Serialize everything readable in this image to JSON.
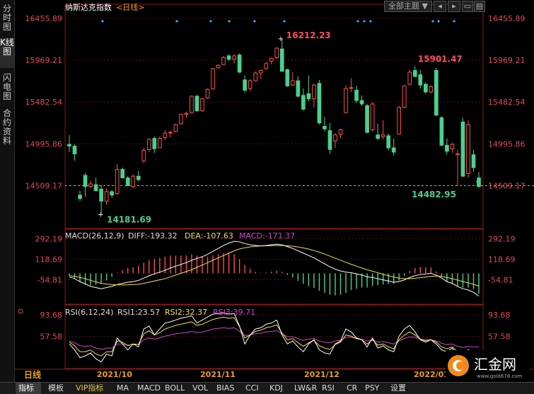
{
  "side_tabs": [
    {
      "label": "分时图",
      "active": false
    },
    {
      "label": "K线图",
      "active": true
    },
    {
      "label": "闪电图",
      "active": false
    },
    {
      "label": "合约资料",
      "active": false
    }
  ],
  "header": {
    "title": "纳斯达克指数",
    "period": "<日线>",
    "theme_button": "全部主题",
    "caret": "▼"
  },
  "colors": {
    "up": "#ff4d4d",
    "down": "#4ccf8f",
    "axis": "#e04a5a",
    "grid": "#5a1010",
    "ma": "#ffffff",
    "dea": "#f0e050",
    "macd": "#cc44cc",
    "rsi1": "#ffffff",
    "rsi2": "#f0e050",
    "rsi3": "#cc44cc",
    "dot": "#4aa3ff"
  },
  "chart_data": {
    "type": "candlestick",
    "ylim": [
      14020,
      16620
    ],
    "price_ticks": [
      "16455.89",
      "15969.21",
      "15482.54",
      "14995.86",
      "14509.17"
    ],
    "last_price_line": "14509.17",
    "x_labels": [
      "2021/10",
      "2021/11",
      "2021/12",
      "2022/01"
    ],
    "annotations": {
      "high": "16212.23",
      "low": "14181.69",
      "peak2": "15901.47",
      "low2": "14482.95"
    },
    "candles": [
      [
        14990,
        15100,
        14900,
        14970
      ],
      [
        14970,
        14990,
        14800,
        14880
      ],
      [
        14400,
        14450,
        14330,
        14360
      ],
      [
        14630,
        14660,
        14380,
        14500
      ],
      [
        14500,
        14570,
        14480,
        14530
      ],
      [
        14520,
        14600,
        14450,
        14450
      ],
      [
        14470,
        14520,
        14180,
        14330
      ],
      [
        14330,
        14480,
        14290,
        14440
      ],
      [
        14440,
        14460,
        14370,
        14400
      ],
      [
        14420,
        14760,
        14400,
        14700
      ],
      [
        14700,
        14720,
        14600,
        14600
      ],
      [
        14600,
        14620,
        14510,
        14510
      ],
      [
        14500,
        14640,
        14480,
        14620
      ],
      [
        14620,
        14680,
        14560,
        14580
      ],
      [
        14800,
        14950,
        14770,
        14920
      ],
      [
        14930,
        15060,
        14900,
        15050
      ],
      [
        15060,
        15080,
        14890,
        14940
      ],
      [
        14950,
        15080,
        14950,
        15060
      ],
      [
        15070,
        15160,
        15040,
        15120
      ],
      [
        15130,
        15150,
        15070,
        15130
      ],
      [
        15140,
        15230,
        15130,
        15220
      ],
      [
        15230,
        15340,
        15220,
        15340
      ],
      [
        15340,
        15370,
        15300,
        15350
      ],
      [
        15360,
        15560,
        15350,
        15550
      ],
      [
        15550,
        15570,
        15370,
        15380
      ],
      [
        15380,
        15530,
        15370,
        15520
      ],
      [
        15530,
        15640,
        15520,
        15630
      ],
      [
        15640,
        15880,
        15620,
        15870
      ],
      [
        15880,
        15920,
        15870,
        15910
      ],
      [
        15920,
        16020,
        15910,
        16000
      ],
      [
        16020,
        16040,
        15960,
        15980
      ],
      [
        15980,
        16040,
        15930,
        16020
      ],
      [
        16030,
        16050,
        15820,
        15830
      ],
      [
        15740,
        15790,
        15590,
        15620
      ],
      [
        15640,
        15750,
        15610,
        15730
      ],
      [
        15730,
        15840,
        15720,
        15820
      ],
      [
        15820,
        15860,
        15750,
        15850
      ],
      [
        15870,
        15950,
        15860,
        15930
      ],
      [
        15960,
        16000,
        15920,
        15990
      ],
      [
        16000,
        16120,
        15980,
        16110
      ],
      [
        16100,
        16210,
        15850,
        15840
      ],
      [
        15860,
        15870,
        15660,
        15670
      ],
      [
        15680,
        15830,
        15670,
        15730
      ],
      [
        15730,
        15780,
        15540,
        15550
      ],
      [
        15560,
        15640,
        15380,
        15400
      ],
      [
        15580,
        15790,
        15490,
        15520
      ],
      [
        15520,
        15700,
        15420,
        15680
      ],
      [
        15700,
        15740,
        15220,
        15240
      ],
      [
        15200,
        15310,
        15140,
        15170
      ],
      [
        15150,
        15240,
        14880,
        14930
      ],
      [
        15030,
        15120,
        14950,
        15100
      ],
      [
        15110,
        15170,
        15060,
        15160
      ],
      [
        15360,
        15680,
        15350,
        15640
      ],
      [
        15650,
        15760,
        15600,
        15650
      ],
      [
        15620,
        15670,
        15470,
        15500
      ],
      [
        15500,
        15560,
        15440,
        15460
      ],
      [
        15440,
        15460,
        15120,
        15130
      ],
      [
        15160,
        15480,
        15140,
        15460
      ],
      [
        15100,
        15230,
        15040,
        15060
      ],
      [
        15080,
        15270,
        15050,
        15100
      ],
      [
        15090,
        15120,
        14920,
        14950
      ],
      [
        14950,
        15060,
        14860,
        14900
      ],
      [
        15110,
        15440,
        15110,
        15420
      ],
      [
        15420,
        15680,
        15410,
        15670
      ],
      [
        15690,
        15860,
        15680,
        15830
      ],
      [
        15850,
        15900,
        15770,
        15780
      ],
      [
        15800,
        15860,
        15640,
        15680
      ],
      [
        15690,
        15710,
        15580,
        15600
      ],
      [
        15600,
        15680,
        15580,
        15660
      ],
      [
        15850,
        15880,
        15320,
        15330
      ],
      [
        15300,
        15320,
        14970,
        14980
      ],
      [
        14980,
        15060,
        14870,
        14910
      ],
      [
        14940,
        15010,
        14890,
        14990
      ],
      [
        14870,
        14930,
        14510,
        14880
      ],
      [
        15250,
        15300,
        14610,
        14620
      ],
      [
        14650,
        15270,
        14600,
        15220
      ],
      [
        14870,
        14930,
        14670,
        14720
      ],
      [
        14600,
        14670,
        14480,
        14500
      ]
    ],
    "macd": {
      "label": "MACD(26,12,9)",
      "diff": "DIFF:-193.32",
      "dea": "DEA:-107.63",
      "macd": "MACD:-171.37",
      "ticks": [
        "292.19",
        "118.69",
        "-54.81"
      ],
      "ylim": [
        -260,
        360
      ],
      "diff_values": [
        -30,
        -45,
        -70,
        -90,
        -110,
        -120,
        -130,
        -120,
        -110,
        -95,
        -85,
        -75,
        -70,
        -60,
        -40,
        -20,
        -5,
        10,
        25,
        45,
        60,
        75,
        90,
        110,
        125,
        140,
        160,
        185,
        210,
        235,
        255,
        270,
        265,
        250,
        240,
        235,
        232,
        235,
        240,
        245,
        240,
        225,
        210,
        190,
        170,
        150,
        130,
        105,
        80,
        55,
        35,
        20,
        10,
        5,
        -5,
        -15,
        -30,
        -35,
        -45,
        -55,
        -65,
        -75,
        -70,
        -55,
        -35,
        -20,
        -10,
        -5,
        0,
        -15,
        -40,
        -70,
        -85,
        -110,
        -130,
        -140,
        -160,
        -193
      ],
      "dea_values": [
        -20,
        -25,
        -35,
        -45,
        -60,
        -72,
        -85,
        -90,
        -95,
        -97,
        -98,
        -97,
        -95,
        -92,
        -85,
        -75,
        -65,
        -55,
        -45,
        -30,
        -15,
        0,
        15,
        30,
        50,
        70,
        90,
        110,
        130,
        150,
        170,
        190,
        205,
        215,
        222,
        228,
        230,
        232,
        233,
        234,
        234,
        232,
        228,
        222,
        214,
        204,
        192,
        178,
        162,
        145,
        128,
        110,
        93,
        76,
        60,
        45,
        30,
        18,
        5,
        -8,
        -20,
        -32,
        -40,
        -45,
        -45,
        -42,
        -37,
        -31,
        -25,
        -23,
        -26,
        -35,
        -45,
        -57,
        -70,
        -80,
        -93,
        -108
      ],
      "hist_values": [
        -20,
        -40,
        -70,
        -90,
        -100,
        -96,
        -90,
        -60,
        -30,
        5,
        26,
        44,
        50,
        64,
        90,
        110,
        120,
        130,
        140,
        150,
        150,
        150,
        150,
        160,
        150,
        140,
        140,
        150,
        160,
        170,
        170,
        160,
        120,
        70,
        36,
        14,
        4,
        6,
        14,
        22,
        12,
        -14,
        -36,
        -64,
        -88,
        -108,
        -124,
        -146,
        -164,
        -180,
        -186,
        -180,
        -166,
        -142,
        -130,
        -120,
        -120,
        -106,
        -100,
        -94,
        -90,
        -86,
        -60,
        -20,
        20,
        44,
        54,
        52,
        50,
        16,
        -28,
        -70,
        -80,
        -106,
        -120,
        -120,
        -134,
        -171
      ]
    },
    "rsi": {
      "label": "RSI(6,12,24)",
      "rsi1": "RSI1:23.57",
      "rsi2": "RSI2:32.37",
      "rsi3": "RSI3:39.71",
      "ticks": [
        "93.68",
        "57.58"
      ],
      "ylim": [
        5,
        108
      ],
      "rsi1_values": [
        45,
        35,
        22,
        25,
        30,
        20,
        15,
        28,
        25,
        55,
        45,
        35,
        45,
        40,
        70,
        75,
        60,
        70,
        80,
        82,
        85,
        88,
        90,
        92,
        80,
        85,
        90,
        95,
        96,
        97,
        95,
        96,
        75,
        45,
        60,
        70,
        72,
        78,
        80,
        85,
        60,
        45,
        50,
        40,
        32,
        45,
        52,
        35,
        30,
        28,
        45,
        50,
        70,
        65,
        55,
        52,
        40,
        55,
        38,
        42,
        35,
        32,
        58,
        70,
        76,
        65,
        52,
        48,
        52,
        45,
        35,
        32,
        38,
        25,
        22,
        35,
        28,
        24
      ],
      "rsi2_values": [
        48,
        42,
        32,
        32,
        35,
        28,
        25,
        32,
        32,
        50,
        48,
        42,
        45,
        44,
        62,
        67,
        60,
        64,
        70,
        73,
        76,
        78,
        80,
        82,
        76,
        78,
        82,
        86,
        88,
        90,
        88,
        89,
        74,
        55,
        60,
        66,
        68,
        72,
        74,
        77,
        63,
        52,
        54,
        47,
        41,
        47,
        51,
        42,
        38,
        36,
        44,
        48,
        60,
        58,
        54,
        52,
        45,
        52,
        43,
        45,
        40,
        37,
        52,
        60,
        65,
        60,
        53,
        50,
        52,
        48,
        40,
        37,
        40,
        32,
        28,
        35,
        32,
        32
      ],
      "rsi3_values": [
        50,
        47,
        42,
        41,
        42,
        38,
        36,
        38,
        38,
        45,
        45,
        43,
        44,
        44,
        52,
        55,
        53,
        55,
        58,
        60,
        62,
        63,
        64,
        66,
        64,
        65,
        67,
        70,
        71,
        72,
        71,
        72,
        66,
        59,
        60,
        62,
        63,
        65,
        66,
        67,
        62,
        57,
        57,
        54,
        51,
        53,
        54,
        50,
        48,
        47,
        50,
        51,
        56,
        56,
        54,
        53,
        50,
        52,
        48,
        49,
        47,
        45,
        50,
        54,
        57,
        56,
        53,
        52,
        52,
        50,
        46,
        44,
        45,
        41,
        39,
        41,
        40,
        40
      ]
    }
  },
  "bottom_tabs": [
    "指标",
    "模板",
    "VIP指标",
    "MA",
    "MACD",
    "BOLL",
    "VOL",
    "BIAS",
    "CCI",
    "KDJ",
    "LW&R",
    "RSI",
    "CR",
    "PSY",
    "设置"
  ],
  "period_label": "日线",
  "logo": {
    "text": "汇金网",
    "url": "www.gold678.com"
  }
}
